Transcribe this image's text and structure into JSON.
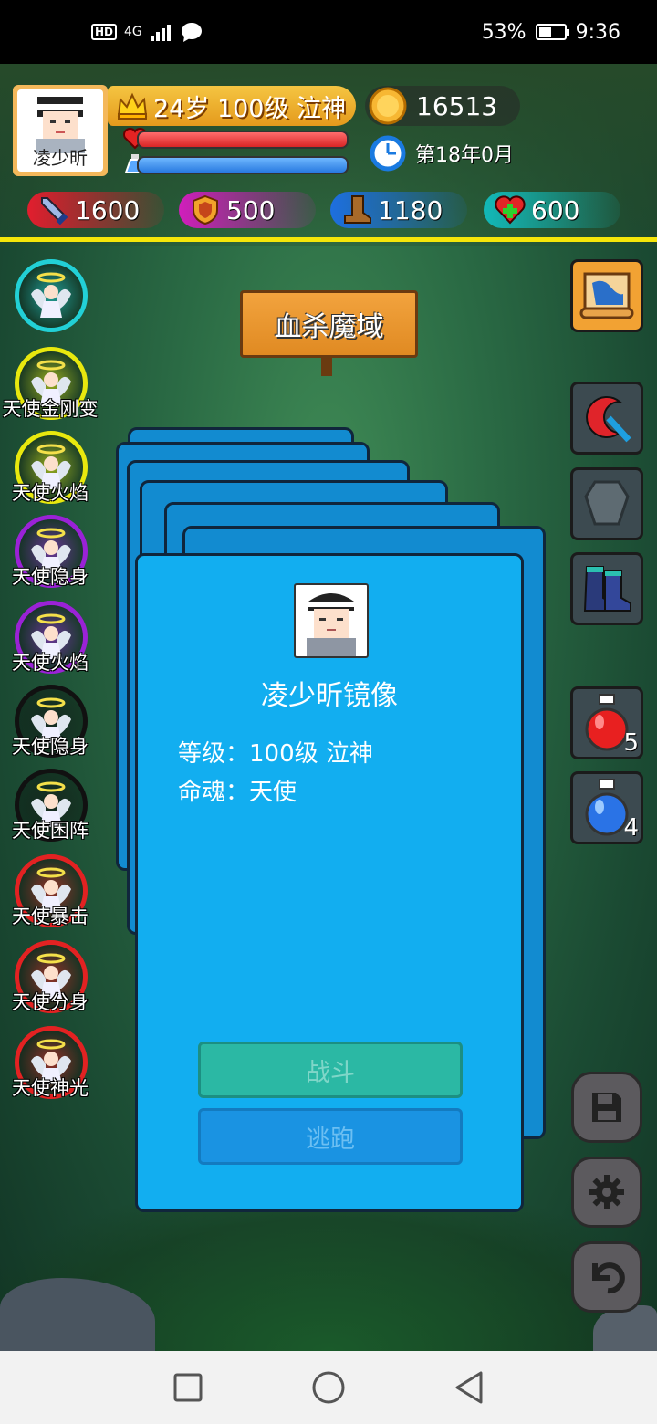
{
  "status_bar": {
    "network": "HD",
    "signal": "4G",
    "battery_percent": "53%",
    "battery_level": 0.53,
    "time": "9:36"
  },
  "player": {
    "name": "凌少昕",
    "level_text": "24岁 100级 泣神",
    "gold": "16513",
    "game_time": "第18年0月",
    "hp_fraction": 1.0,
    "mp_fraction": 1.0,
    "stats": {
      "attack": "1600",
      "defense": "500",
      "speed": "1180",
      "heal": "600"
    }
  },
  "location": {
    "name": "血杀魔域"
  },
  "skills": [
    {
      "label": "",
      "ring_color": "#22d0d6"
    },
    {
      "label": "天使金刚变",
      "ring_color": "#e8e80e"
    },
    {
      "label": "天使火焰",
      "ring_color": "#e8e80e"
    },
    {
      "label": "天使隐身",
      "ring_color": "#9a22d6"
    },
    {
      "label": "天使火焰",
      "ring_color": "#9a22d6"
    },
    {
      "label": "天使隐身",
      "ring_color": "#111111"
    },
    {
      "label": "天使困阵",
      "ring_color": "#111111"
    },
    {
      "label": "天使暴击",
      "ring_color": "#e22222"
    },
    {
      "label": "天使分身",
      "ring_color": "#e22222"
    },
    {
      "label": "天使神光",
      "ring_color": "#e22222"
    }
  ],
  "items": {
    "red_potion_count": "5",
    "blue_potion_count": "4"
  },
  "encounter": {
    "enemy_name": "凌少昕镜像",
    "level_line": "等级：100级 泣神",
    "soul_line": "命魂：天使",
    "fight_label": "战斗",
    "flee_label": "逃跑"
  },
  "colors": {
    "card": "#12aef0",
    "card_back": "#128bd0",
    "highlight_line": "#f5e60a"
  }
}
